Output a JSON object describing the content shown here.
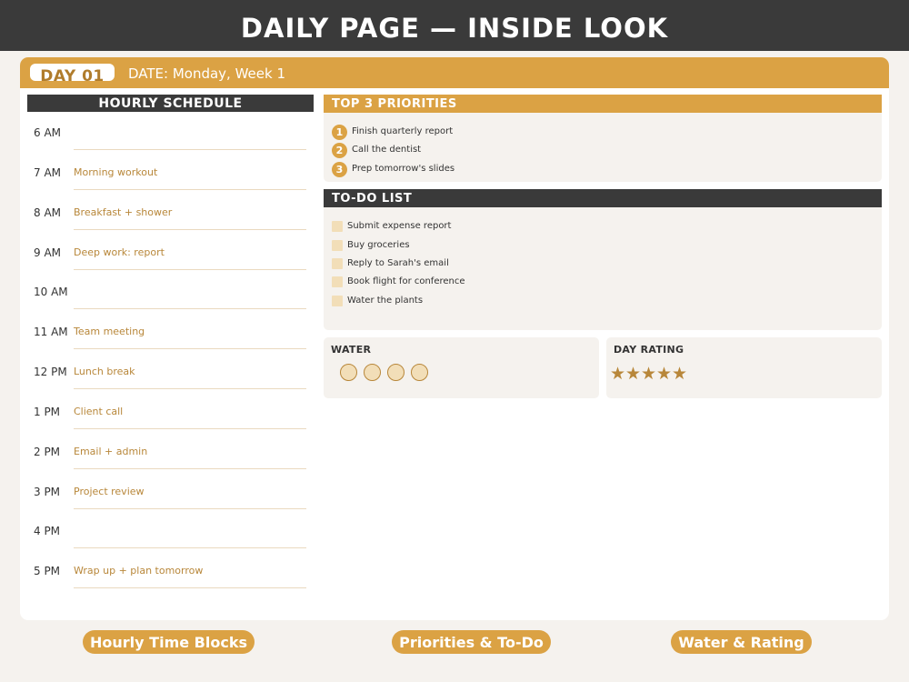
{
  "page": {
    "banner_title": "DAILY PAGE — INSIDE LOOK"
  },
  "header": {
    "day_label": "DAY 01",
    "date_line": "DATE: Monday, Week 1"
  },
  "schedule": {
    "title": "HOURLY SCHEDULE",
    "rows": [
      {
        "time": "6 AM",
        "task": ""
      },
      {
        "time": "7 AM",
        "task": "Morning workout"
      },
      {
        "time": "8 AM",
        "task": "Breakfast + shower"
      },
      {
        "time": "9 AM",
        "task": "Deep work: report"
      },
      {
        "time": "10 AM",
        "task": ""
      },
      {
        "time": "11 AM",
        "task": "Team meeting"
      },
      {
        "time": "12 PM",
        "task": "Lunch break"
      },
      {
        "time": "1 PM",
        "task": "Client call"
      },
      {
        "time": "2 PM",
        "task": "Email + admin"
      },
      {
        "time": "3 PM",
        "task": "Project review"
      },
      {
        "time": "4 PM",
        "task": ""
      },
      {
        "time": "5 PM",
        "task": "Wrap up + plan tomorrow"
      }
    ]
  },
  "priorities": {
    "title": "TOP 3 PRIORITIES",
    "items": [
      {
        "num": "1",
        "text": "Finish quarterly report"
      },
      {
        "num": "2",
        "text": "Call the dentist"
      },
      {
        "num": "3",
        "text": "Prep tomorrow's slides"
      }
    ]
  },
  "todo": {
    "title": "TO-DO LIST",
    "items": [
      {
        "text": "Submit expense report",
        "checked": false
      },
      {
        "text": "Buy groceries",
        "checked": false
      },
      {
        "text": "Reply to Sarah's email",
        "checked": false
      },
      {
        "text": "Book flight for conference",
        "checked": false
      },
      {
        "text": "Water the plants",
        "checked": false
      }
    ]
  },
  "water": {
    "title": "WATER",
    "glasses_total": 4,
    "glasses_filled": 4
  },
  "rating": {
    "title": "DAY RATING",
    "stars": 5,
    "max": 5,
    "star_glyph": "★"
  },
  "footer_tags": [
    "Hourly Time Blocks",
    "Priorities & To-Do",
    "Water & Rating"
  ],
  "colors": {
    "accent": "#dba244",
    "dark": "#3a3a3a",
    "task_text": "#b8873a",
    "panel_bg": "#f5f2ee"
  }
}
